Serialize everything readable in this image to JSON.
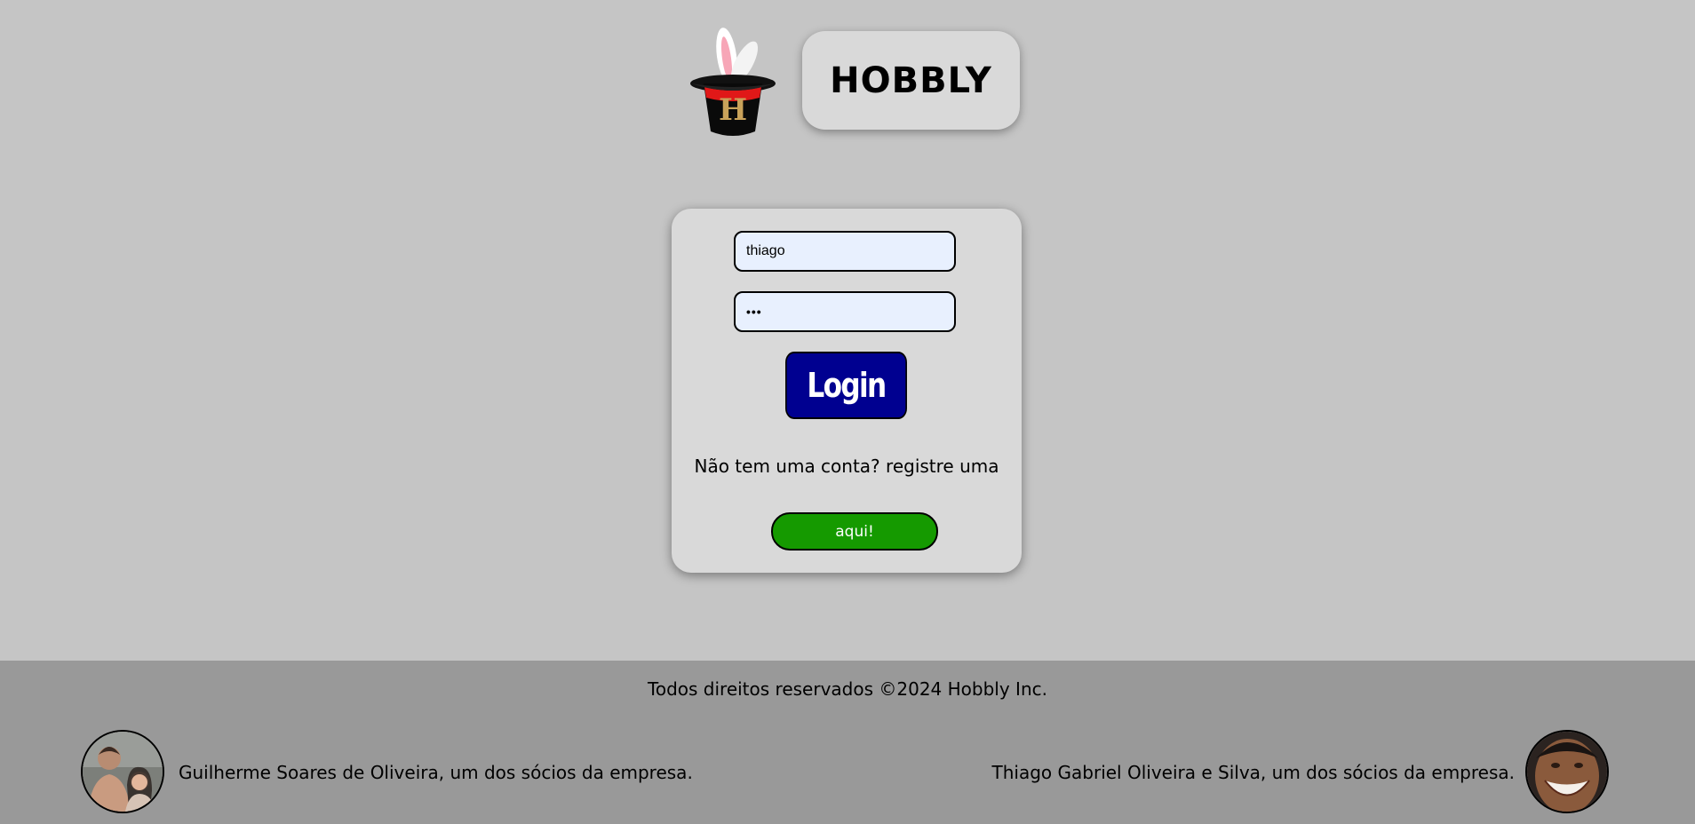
{
  "header": {
    "brand": "HOBBLY",
    "logo_icon": "magic-hat-rabbit-icon",
    "logo_letter": "H"
  },
  "login": {
    "username_value": "thiago",
    "password_mask": "•••",
    "login_label": "Login",
    "register_prompt": "Não tem uma conta? registre uma",
    "register_label": "aqui!"
  },
  "footer": {
    "copyright": "Todos direitos reservados ©2024 Hobbly Inc.",
    "partners": [
      {
        "text": "Guilherme Soares de Oliveira, um dos sócios da empresa.",
        "avatar": "partner-photo"
      },
      {
        "text": "Thiago Gabriel Oliveira e Silva, um dos sócios da empresa.",
        "avatar": "partner-photo"
      }
    ]
  },
  "colors": {
    "background": "#c5c5c5",
    "card": "#d9d9d9",
    "login_button": "#000090",
    "register_button": "#159a00",
    "input_bg": "#e8f0fe",
    "footer": "#999999"
  }
}
